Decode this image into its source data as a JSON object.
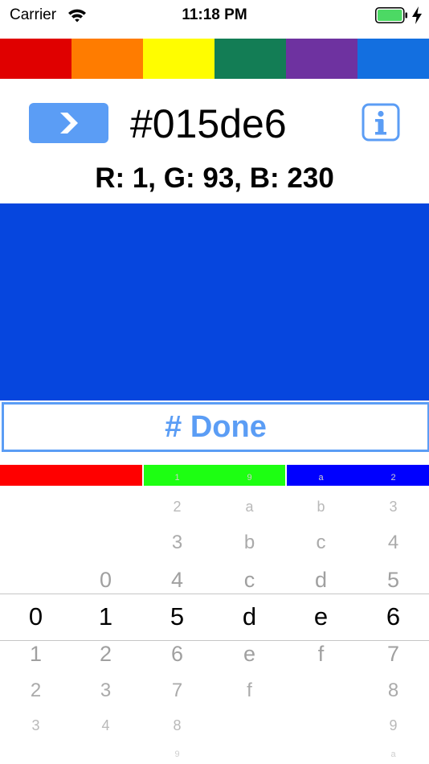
{
  "status_bar": {
    "carrier": "Carrier",
    "time": "11:18 PM"
  },
  "palette": [
    {
      "name": "red",
      "color": "#e00000"
    },
    {
      "name": "orange",
      "color": "#ff7c00"
    },
    {
      "name": "yellow",
      "color": "#fffd00"
    },
    {
      "name": "green",
      "color": "#137d55"
    },
    {
      "name": "purple",
      "color": "#6e32a0"
    },
    {
      "name": "blue",
      "color": "#136fe0"
    }
  ],
  "hex_value": "#015de6",
  "rgb_text": "R: 1, G: 93, B: 230",
  "swatch_color": "#0646de",
  "accent_color": "#5b9df5",
  "done_label": "# Done",
  "channel_bars": [
    {
      "name": "red",
      "color": "#ff0000",
      "fraction": 0.00392
    },
    {
      "name": "green",
      "color": "#1dff12",
      "fraction": 0.3647
    },
    {
      "name": "blue",
      "color": "#0000ff",
      "fraction": 0.902
    }
  ],
  "picker": {
    "columns": [
      {
        "selected": "0",
        "above": [
          "",
          "",
          "",
          ""
        ],
        "below": [
          "1",
          "2",
          "3",
          ""
        ]
      },
      {
        "selected": "1",
        "above": [
          "0",
          "",
          "",
          ""
        ],
        "below": [
          "2",
          "3",
          "4",
          ""
        ]
      },
      {
        "selected": "5",
        "above": [
          "4",
          "3",
          "2",
          "1"
        ],
        "below": [
          "6",
          "7",
          "8",
          "9"
        ]
      },
      {
        "selected": "d",
        "above": [
          "c",
          "b",
          "a",
          "9"
        ],
        "below": [
          "e",
          "f",
          "",
          ""
        ]
      },
      {
        "selected": "e",
        "above": [
          "d",
          "c",
          "b",
          "a"
        ],
        "below": [
          "f",
          "",
          "",
          ""
        ]
      },
      {
        "selected": "6",
        "above": [
          "5",
          "4",
          "3",
          "2"
        ],
        "below": [
          "7",
          "8",
          "9",
          "a"
        ]
      }
    ]
  }
}
